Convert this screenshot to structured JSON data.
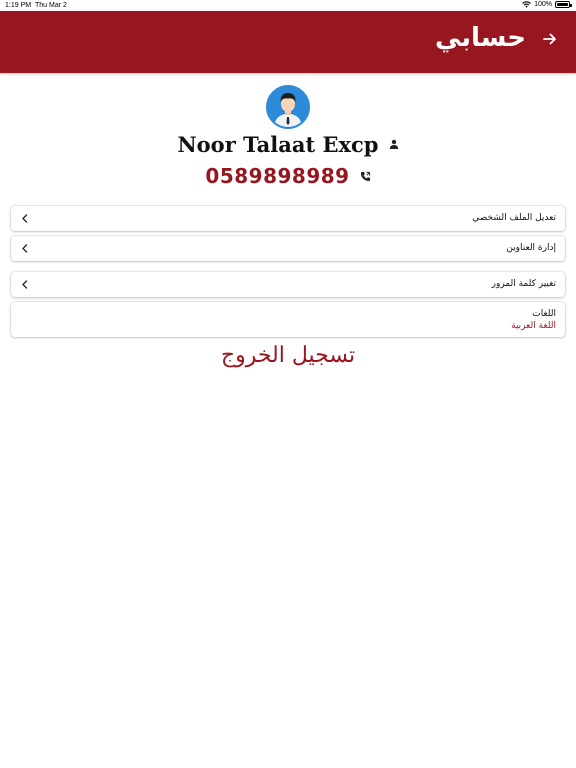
{
  "status_bar": {
    "time": "1:19 PM",
    "date": "Thu Mar 2",
    "battery": "100%"
  },
  "header": {
    "title": "حسابي",
    "back_icon": "arrow-right-icon",
    "background": "#98161f"
  },
  "profile": {
    "name": "Noor Talaat Excp",
    "phone": "0589898989",
    "name_icon": "person-icon",
    "phone_icon": "phone-icon"
  },
  "menu": {
    "edit_profile": "تعديل الملف الشخصي",
    "manage_addresses": "إدارة العناوين",
    "change_password": "تغيير كلمة المرور",
    "languages_title": "اللغات",
    "languages_value": "اللغة العربية"
  },
  "logout_label": "تسجيل الخروج",
  "colors": {
    "accent": "#98161f",
    "avatar_bg": "#2d8ad8"
  }
}
